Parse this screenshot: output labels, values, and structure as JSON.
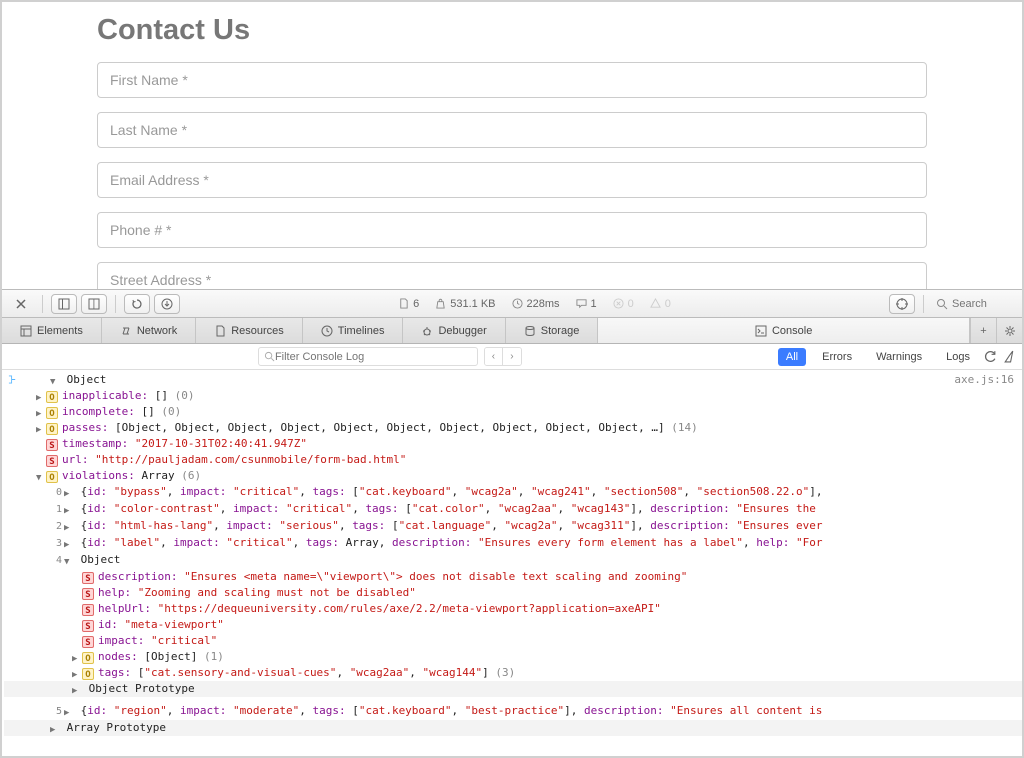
{
  "page": {
    "title": "Contact Us",
    "fields": {
      "first_name": "First Name *",
      "last_name": "Last Name *",
      "email": "Email Address *",
      "phone": "Phone # *",
      "street": "Street Address *"
    }
  },
  "toolbar": {
    "resources": "6",
    "size": "531.1 KB",
    "time": "228ms",
    "logs": "1",
    "errors": "0",
    "warnings": "0",
    "search_placeholder": "Search"
  },
  "tabs": {
    "elements": "Elements",
    "network": "Network",
    "resources": "Resources",
    "timelines": "Timelines",
    "debugger": "Debugger",
    "storage": "Storage",
    "console": "Console"
  },
  "filter": {
    "placeholder": "Filter Console Log",
    "all": "All",
    "errors": "Errors",
    "warnings": "Warnings",
    "logs": "Logs"
  },
  "console": {
    "source": "axe.js:16",
    "object": "Object",
    "inapplicable": {
      "label": "inapplicable:",
      "value": "[]",
      "count": "(0)"
    },
    "incomplete": {
      "label": "incomplete:",
      "value": "[]",
      "count": "(0)"
    },
    "passes": {
      "label": "passes:",
      "value": "[Object, Object, Object, Object, Object, Object, Object, Object, Object, Object, …]",
      "count": "(14)"
    },
    "timestamp": {
      "label": "timestamp:",
      "value": "\"2017-10-31T02:40:41.947Z\""
    },
    "url": {
      "label": "url:",
      "value": "\"http://pauljadam.com/csunmobile/form-bad.html\""
    },
    "violations": {
      "label": "violations:",
      "value": "Array",
      "count": "(6)"
    },
    "items": [
      {
        "idx": "0",
        "id": "\"bypass\"",
        "impact": "\"critical\"",
        "tags": "[\"cat.keyboard\", \"wcag2a\", \"wcag241\", \"section508\", \"section508.22.o\"]"
      },
      {
        "idx": "1",
        "id": "\"color-contrast\"",
        "impact": "\"critical\"",
        "tags": "[\"cat.color\", \"wcag2aa\", \"wcag143\"]",
        "description": "\"Ensures the"
      },
      {
        "idx": "2",
        "id": "\"html-has-lang\"",
        "impact": "\"serious\"",
        "tags": "[\"cat.language\", \"wcag2a\", \"wcag311\"]",
        "description": "\"Ensures ever"
      },
      {
        "idx": "3",
        "id": "\"label\"",
        "impact": "\"critical\"",
        "tags": "Array",
        "description": "\"Ensures every form element has a label\"",
        "help": "\"For"
      },
      {
        "idx": "4",
        "expanded": {
          "description": "\"Ensures <meta name=\\\"viewport\\\"> does not disable text scaling and zooming\"",
          "help": "\"Zooming and scaling must not be disabled\"",
          "helpUrl": "\"https://dequeuniversity.com/rules/axe/2.2/meta-viewport?application=axeAPI\"",
          "id": "\"meta-viewport\"",
          "impact": "\"critical\"",
          "nodes": "[Object]",
          "nodes_count": "(1)",
          "tags": "[\"cat.sensory-and-visual-cues\", \"wcag2aa\", \"wcag144\"]",
          "tags_count": "(3)"
        }
      },
      {
        "idx": "5",
        "id": "\"region\"",
        "impact": "\"moderate\"",
        "tags": "[\"cat.keyboard\", \"best-practice\"]",
        "description": "\"Ensures all content is"
      }
    ],
    "proto_object": "Object Prototype",
    "proto_array": "Array Prototype"
  }
}
